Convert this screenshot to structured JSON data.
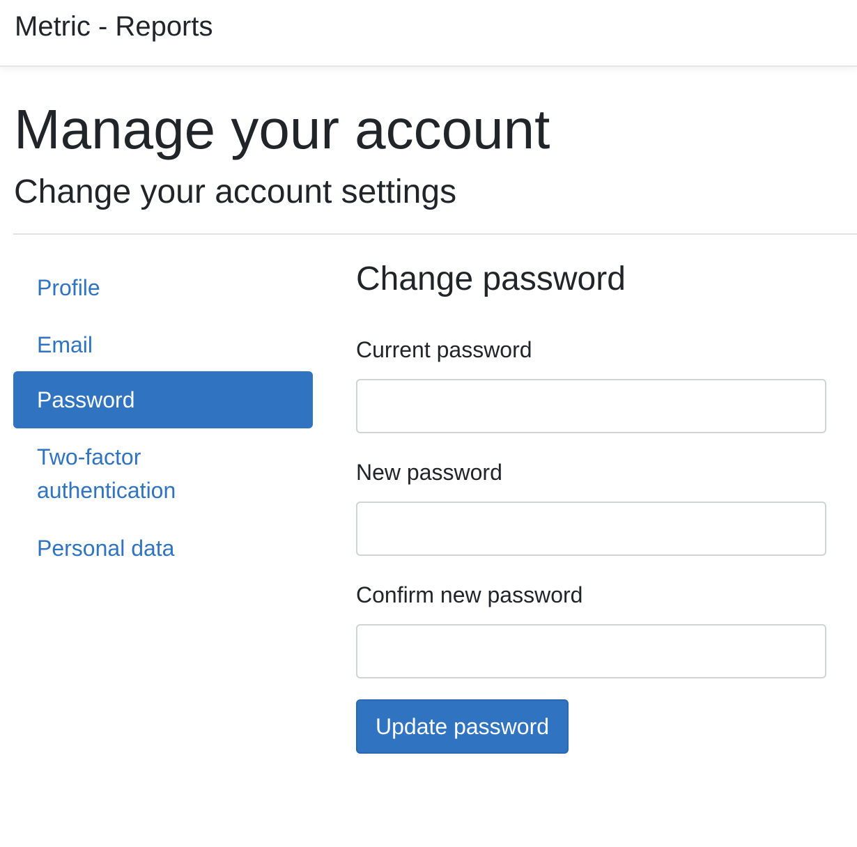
{
  "navbar": {
    "brand": "Metric - Reports"
  },
  "header": {
    "title": "Manage your account",
    "subtitle": "Change your account settings"
  },
  "sidebar": {
    "items": [
      {
        "label": "Profile",
        "active": false
      },
      {
        "label": "Email",
        "active": false
      },
      {
        "label": "Password",
        "active": true
      },
      {
        "label": "Two-factor authentication",
        "active": false
      },
      {
        "label": "Personal data",
        "active": false
      }
    ]
  },
  "form": {
    "title": "Change password",
    "current_password": {
      "label": "Current password",
      "value": ""
    },
    "new_password": {
      "label": "New password",
      "value": ""
    },
    "confirm_password": {
      "label": "Confirm new password",
      "value": ""
    },
    "submit_label": "Update password"
  },
  "colors": {
    "accent": "#2f73c1",
    "text": "#212529",
    "border": "#ced4da"
  }
}
